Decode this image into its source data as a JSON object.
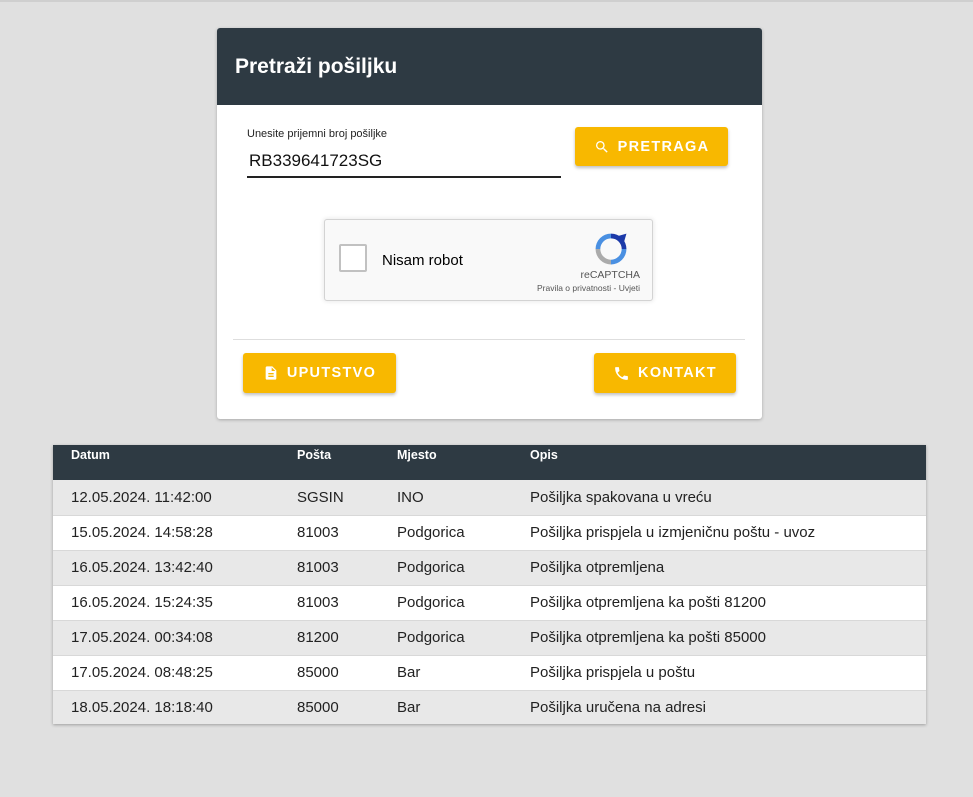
{
  "search_card": {
    "title": "Pretraži pošiljku",
    "field_label": "Unesite prijemni broj pošiljke",
    "field_value": "RB339641723SG",
    "search_button": "PRETRAGA",
    "search_icon": "search-icon",
    "guide_button": "UPUTSTVO",
    "guide_icon": "document-icon",
    "contact_button": "KONTAKT",
    "contact_icon": "phone-icon"
  },
  "recaptcha": {
    "checkbox_label": "Nisam robot",
    "brand": "reCAPTCHA",
    "privacy_link": "Pravila o privatnosti",
    "separator": "-",
    "terms_link": "Uvjeti"
  },
  "tracking_table": {
    "columns": [
      "Datum",
      "Pošta",
      "Mjesto",
      "Opis"
    ],
    "rows": [
      [
        "12.05.2024. 11:42:00",
        "SGSIN",
        "INO",
        "Pošiljka spakovana u vreću"
      ],
      [
        "15.05.2024. 14:58:28",
        "81003",
        "Podgorica",
        "Pošiljka prispjela u izmjeničnu poštu - uvoz"
      ],
      [
        "16.05.2024. 13:42:40",
        "81003",
        "Podgorica",
        "Pošiljka otpremljena"
      ],
      [
        "16.05.2024. 15:24:35",
        "81003",
        "Podgorica",
        "Pošiljka otpremljena ka pošti 81200"
      ],
      [
        "17.05.2024. 00:34:08",
        "81200",
        "Podgorica",
        "Pošiljka otpremljena ka pošti 85000"
      ],
      [
        "17.05.2024. 08:48:25",
        "85000",
        "Bar",
        "Pošiljka prispjela u poštu"
      ],
      [
        "18.05.2024. 18:18:40",
        "85000",
        "Bar",
        "Pošiljka uručena na adresi"
      ]
    ]
  },
  "colors": {
    "header_bg": "#2e3a43",
    "accent": "#f8b800",
    "page_bg": "#e0e0e0"
  }
}
